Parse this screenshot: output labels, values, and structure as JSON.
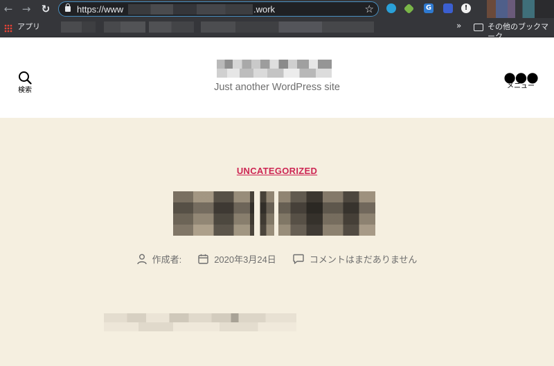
{
  "browser": {
    "url_prefix": "https://www",
    "url_suffix": ".work",
    "bookmarks_bar": {
      "apps_label": "アプリ",
      "overflow_label": "»",
      "other_bookmarks_label": "その他のブックマーク"
    },
    "icons": [
      "back-icon",
      "forward-icon",
      "reload-icon",
      "lock-icon",
      "star-icon",
      "extension-icons",
      "apps-icon",
      "folder-icon"
    ]
  },
  "site": {
    "search_label": "検索",
    "menu_label": "メニュー",
    "tagline": "Just another WordPress site"
  },
  "post": {
    "category": "UNCATEGORIZED",
    "author_label": "作成者:",
    "date": "2020年3月24日",
    "comments": "コメントはまだありません"
  },
  "colors": {
    "accent": "#cd2653",
    "page_background": "#f5efe0",
    "header_background": "#ffffff",
    "chrome_background": "#35363a"
  }
}
